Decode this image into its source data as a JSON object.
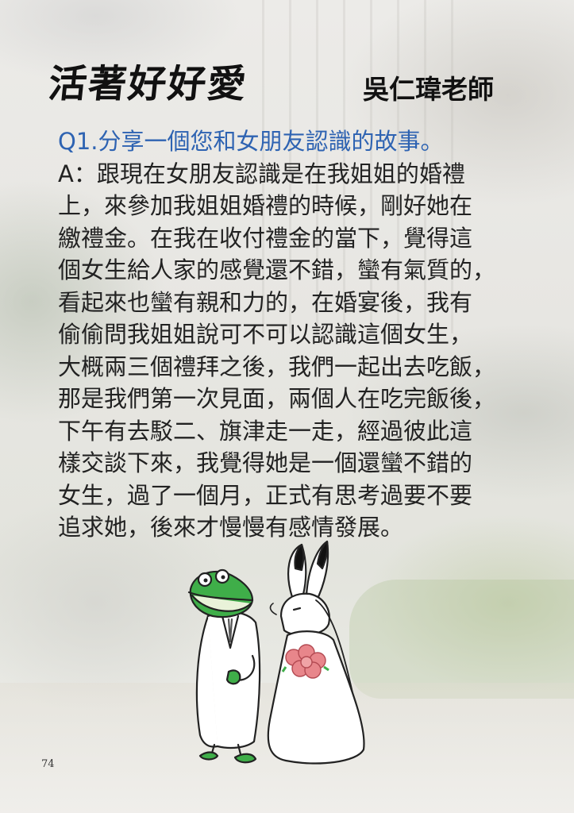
{
  "page": {
    "title": "活著好好愛",
    "author": "吳仁瑋老師",
    "page_number": "74"
  },
  "article": {
    "question": "Q1.分享一個您和女朋友認識的故事。",
    "answer_lines": [
      "A：跟現在女朋友認識是在我姐姐的婚禮",
      "上，來參加我姐姐婚禮的時候，剛好她在",
      "繳禮金。在我在收付禮金的當下，覺得這",
      "個女生給人家的感覺還不錯，蠻有氣質的，",
      "看起來也蠻有親和力的，在婚宴後，我有",
      "偷偷問我姐姐說可不可以認識這個女生，",
      "大概兩三個禮拜之後，我們一起出去吃飯，",
      "那是我們第一次見面，兩個人在吃完飯後，",
      "下午有去駁二、旗津走一走，經過彼此這",
      "樣交談下來，我覺得她是一個還蠻不錯的",
      "女生，過了一個月，正式有思考過要不要",
      "追求她，後來才慢慢有感情發展。"
    ]
  },
  "colors": {
    "question": "#2e63b2",
    "body_text": "#222222",
    "frog_green": "#3fae49",
    "bouquet_pink": "#e8868b"
  },
  "illustration": {
    "left_figure": "frog-groom-icon",
    "right_figure": "rabbit-bride-icon"
  }
}
